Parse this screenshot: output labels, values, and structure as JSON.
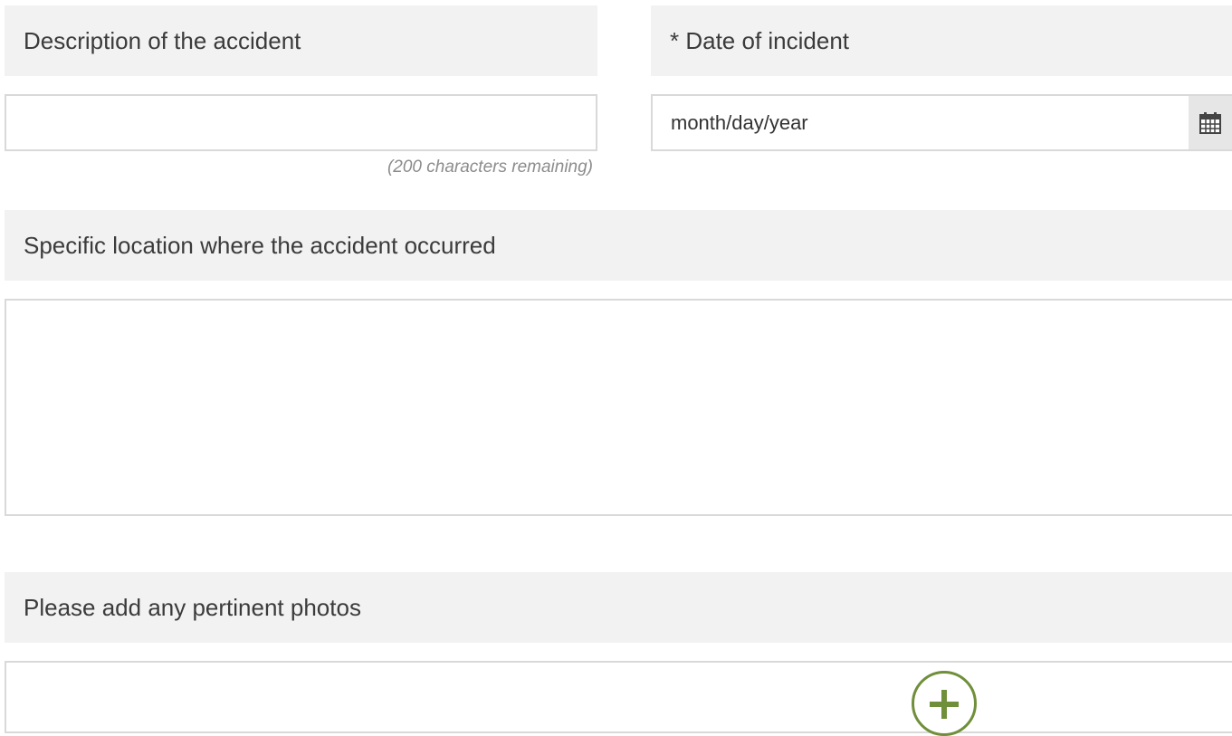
{
  "description": {
    "label": "Description of the accident",
    "value": "",
    "hint": "(200 characters remaining)"
  },
  "date_of_incident": {
    "label": "* Date of incident",
    "placeholder": "month/day/year",
    "icon": "calendar-icon"
  },
  "location": {
    "label": "Specific location where the accident occurred",
    "value": ""
  },
  "photos": {
    "label": "Please add any pertinent photos",
    "add_icon": "plus-circle-icon"
  },
  "colors": {
    "label_bg": "#f2f2f2",
    "border": "#d9d9d9",
    "accent_green": "#6f8f3a"
  }
}
